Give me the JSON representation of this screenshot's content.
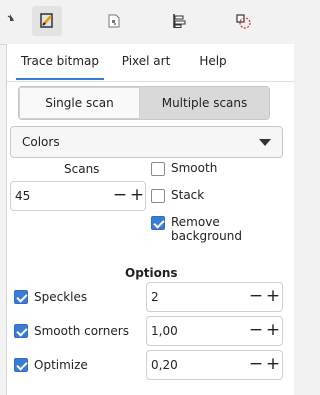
{
  "toolbar": {
    "icons": [
      "trace-bitmap-icon",
      "pixel-art-trace-icon",
      "align-distribute-icon",
      "transform-selection-icon"
    ]
  },
  "tabs": [
    {
      "label": "Trace bitmap"
    },
    {
      "label": "Pixel art"
    },
    {
      "label": "Help"
    }
  ],
  "scan_mode": {
    "single": "Single scan",
    "multiple": "Multiple scans",
    "selected": "Multiple scans"
  },
  "mode_dropdown": {
    "value": "Colors"
  },
  "scans": {
    "label": "Scans",
    "value": "45"
  },
  "options_right": [
    {
      "label": "Smooth",
      "checked": false
    },
    {
      "label": "Stack",
      "checked": false
    },
    {
      "label": "Remove background",
      "checked": true
    }
  ],
  "options": {
    "title": "Options",
    "rows": [
      {
        "label": "Speckles",
        "checked": true,
        "value": "2"
      },
      {
        "label": "Smooth corners",
        "checked": true,
        "value": "1,00"
      },
      {
        "label": "Optimize",
        "checked": true,
        "value": "0,20"
      }
    ]
  },
  "colors": {
    "accent": "#3a7bd5",
    "selection_red": "#d33"
  }
}
